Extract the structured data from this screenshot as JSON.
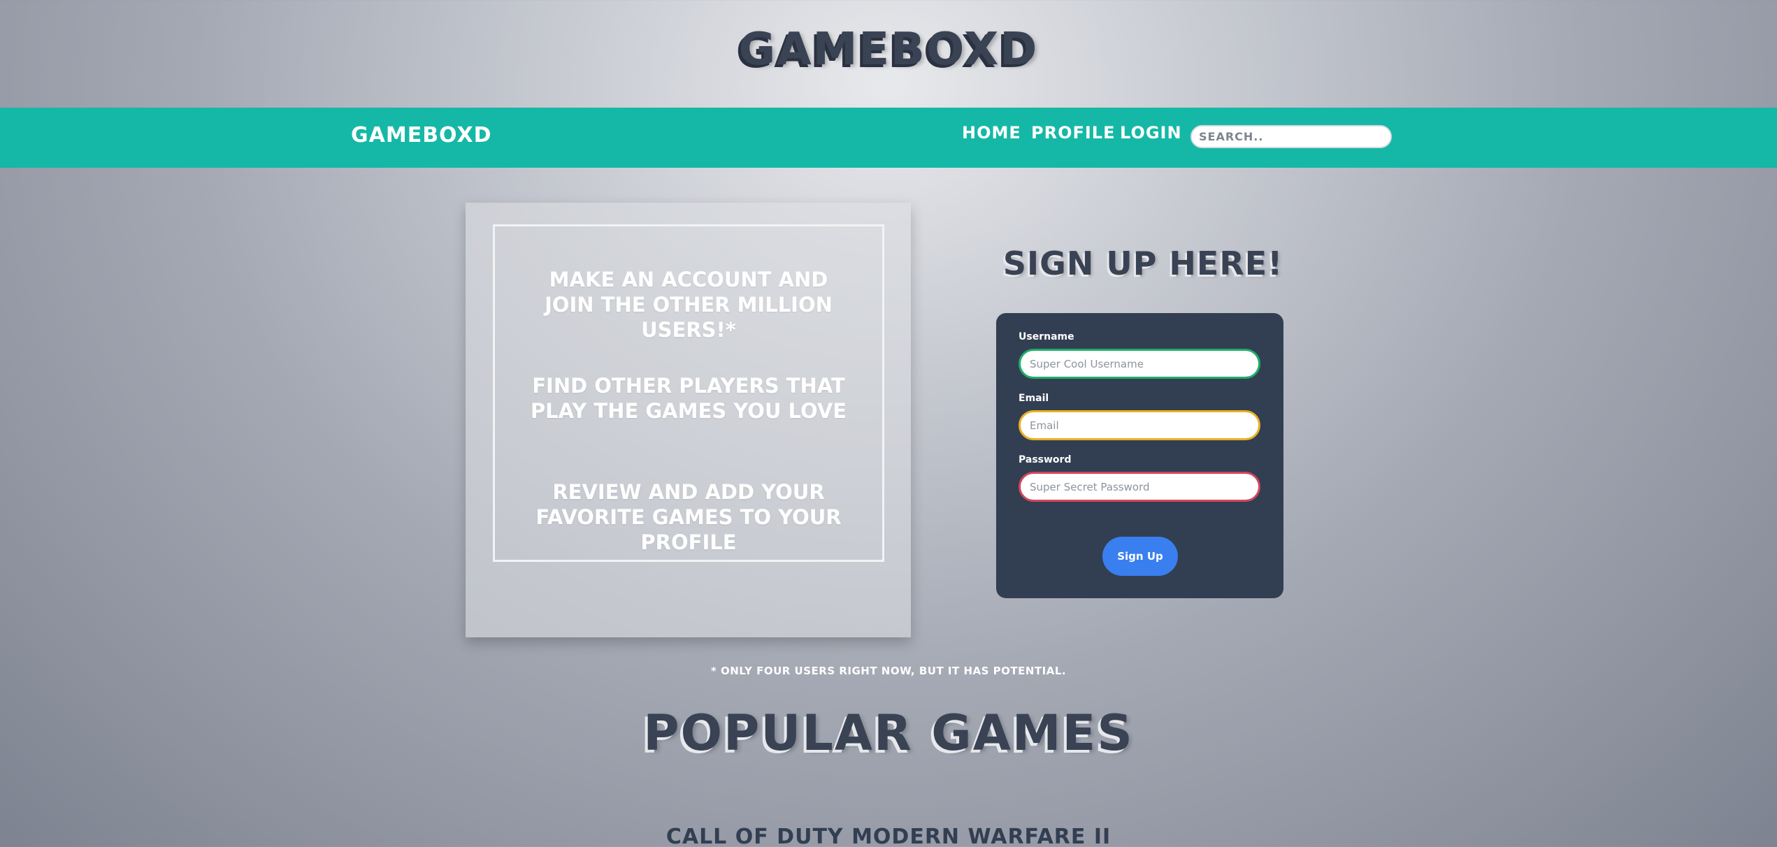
{
  "header": {
    "title": "GAMEBOXD"
  },
  "navbar": {
    "brand": "GAMEBOXD",
    "links": [
      "HOME",
      "PROFILE",
      "LOGIN"
    ],
    "search_placeholder": "SEARCH.."
  },
  "info": {
    "lines": [
      "MAKE AN ACCOUNT AND JOIN THE OTHER MILLION USERS!*",
      "FIND OTHER PLAYERS THAT PLAY THE GAMES YOU LOVE",
      "REVIEW AND ADD YOUR FAVORITE GAMES TO YOUR PROFILE"
    ]
  },
  "signup": {
    "title": "SIGN UP HERE!",
    "username_label": "Username",
    "username_placeholder": "Super Cool Username",
    "email_label": "Email",
    "email_placeholder": "Email",
    "password_label": "Password",
    "password_placeholder": "Super Secret Password",
    "button": "Sign Up",
    "field_colors": {
      "username": "#1fae6a",
      "email": "#e9b224",
      "password": "#d2465a"
    },
    "button_color": "#3a7ff0"
  },
  "footnote": "* ONLY FOUR USERS RIGHT NOW, BUT IT HAS POTENTIAL.",
  "popular": {
    "title": "POPULAR GAMES",
    "games": [
      "CALL OF DUTY MODERN WARFARE II"
    ]
  },
  "colors": {
    "navbar": "#15b8a6",
    "card": "#323f52",
    "heading": "#3a4354"
  }
}
